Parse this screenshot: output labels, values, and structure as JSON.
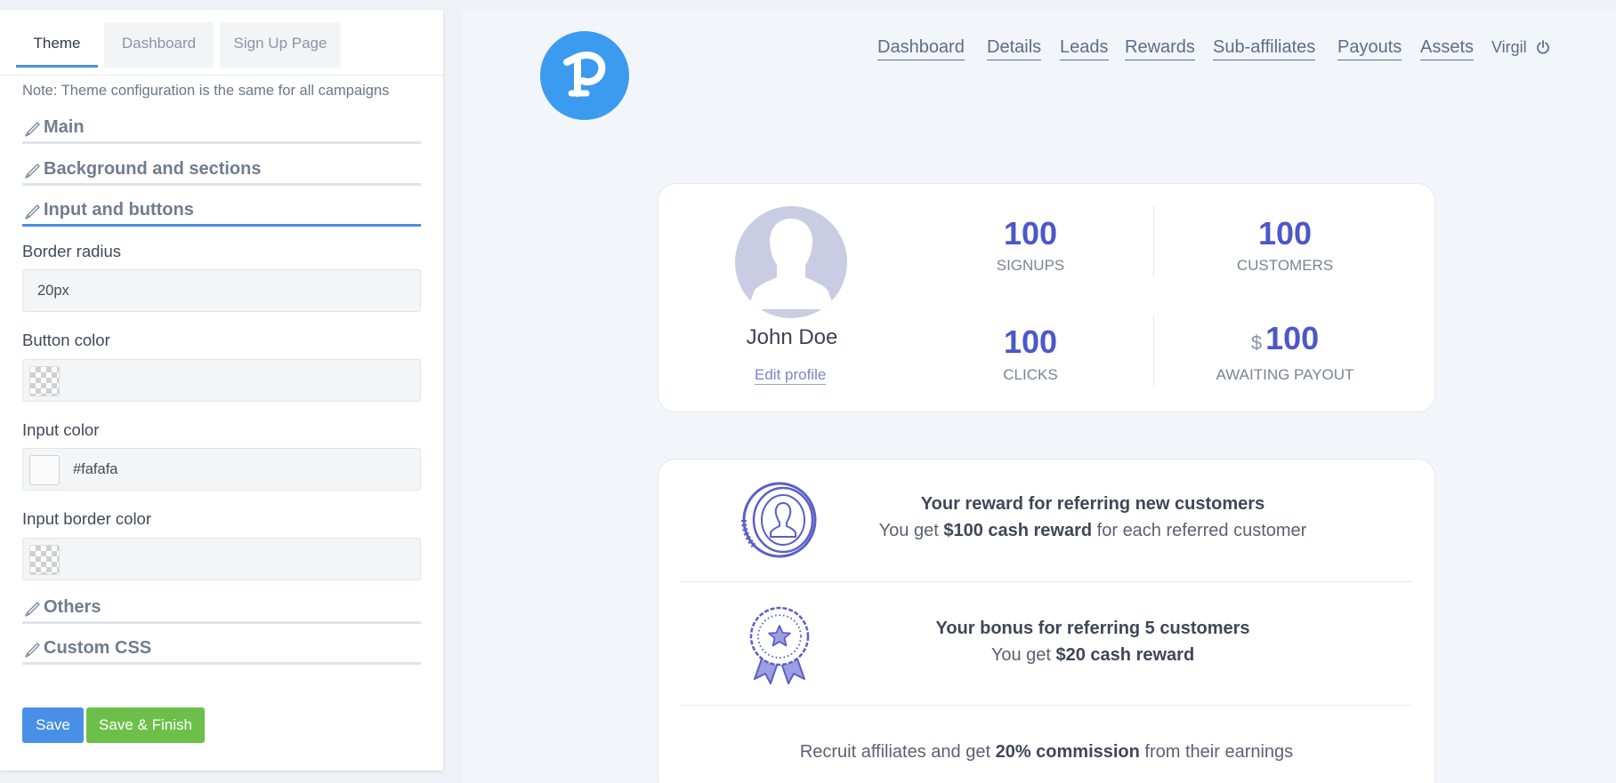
{
  "editor": {
    "tabs": [
      {
        "label": "Theme",
        "active": true
      },
      {
        "label": "Dashboard",
        "active": false
      },
      {
        "label": "Sign Up Page",
        "active": false
      }
    ],
    "note": "Note: Theme configuration is the same for all campaigns",
    "sections": {
      "main": "Main",
      "background": "Background and sections",
      "input_buttons": "Input and buttons",
      "others": "Others",
      "custom_css": "Custom CSS"
    },
    "fields": {
      "border_radius": {
        "label": "Border radius",
        "value": "20px"
      },
      "button_color": {
        "label": "Button color",
        "value": ""
      },
      "input_color": {
        "label": "Input color",
        "value": "#fafafa"
      },
      "input_border_color": {
        "label": "Input border color",
        "value": ""
      }
    },
    "buttons": {
      "save": "Save",
      "save_finish": "Save & Finish"
    },
    "colors": {
      "accent": "#4a8fe7",
      "success": "#6cc04a"
    }
  },
  "preview": {
    "nav": [
      "Dashboard",
      "Details",
      "Leads",
      "Rewards",
      "Sub-affiliates",
      "Payouts",
      "Assets"
    ],
    "user": "Virgil",
    "icons": {
      "logo": "brand-logo-icon",
      "power": "power-icon",
      "avatar": "user-silhouette-icon",
      "coin": "coin-user-icon",
      "badge": "award-star-icon"
    },
    "profile": {
      "name": "John Doe",
      "edit": "Edit profile"
    },
    "stats": {
      "signups": {
        "value": "100",
        "label": "SIGNUPS"
      },
      "customers": {
        "value": "100",
        "label": "CUSTOMERS"
      },
      "clicks": {
        "value": "100",
        "label": "CLICKS"
      },
      "payout": {
        "currency": "$",
        "value": "100",
        "label": "AWAITING PAYOUT"
      }
    },
    "rewards": {
      "referral_title": "Your reward for referring new customers",
      "referral_prefix": "You get ",
      "referral_bold": "$100 cash reward",
      "referral_suffix": " for each referred customer",
      "bonus_title": "Your bonus for referring 5 customers",
      "bonus_prefix": "You get ",
      "bonus_bold": "$20 cash reward",
      "recruit_prefix": "Recruit affiliates and get ",
      "recruit_bold": "20% commission",
      "recruit_suffix": " from their earnings"
    },
    "colors": {
      "brand": "#3b9bef",
      "stat": "#4c57c9",
      "icon": "#5b5fc7"
    }
  }
}
